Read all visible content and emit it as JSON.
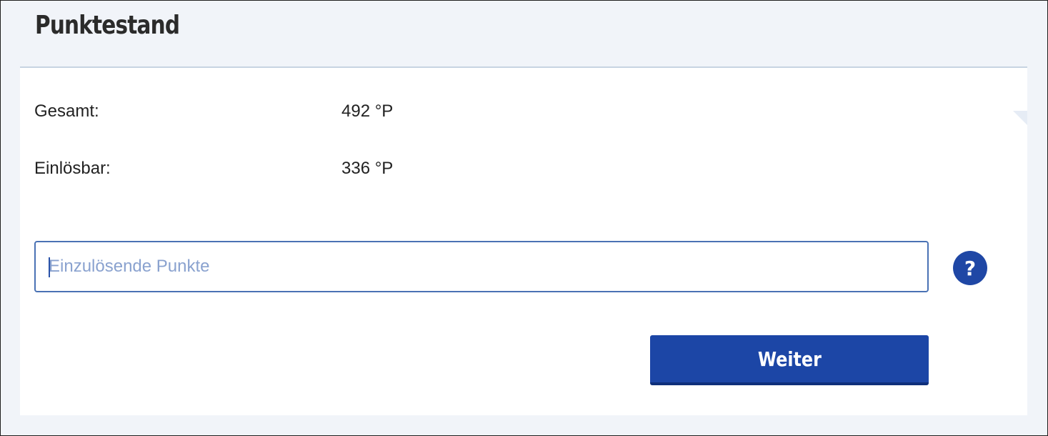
{
  "page": {
    "title": "Punktestand"
  },
  "points": {
    "rows": [
      {
        "label": "Gesamt:",
        "value": "492 °P"
      },
      {
        "label": "Einlösbar:",
        "value": "336 °P"
      }
    ]
  },
  "redeem": {
    "input_placeholder": "Einzulösende Punkte",
    "input_value": "",
    "help_icon": "question-mark-icon",
    "help_glyph": "?",
    "submit_label": "Weiter"
  },
  "colors": {
    "background": "#f1f4f9",
    "card": "#ffffff",
    "accent": "#1c46a6",
    "input_border": "#4a72b4",
    "placeholder": "#8aa2cf"
  }
}
